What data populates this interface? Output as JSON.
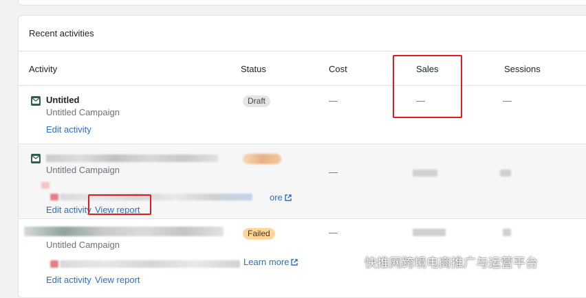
{
  "card": {
    "title": "Recent activities"
  },
  "columns": [
    "Activity",
    "Status",
    "Cost",
    "Sales",
    "Sessions"
  ],
  "rows": [
    {
      "name": "Untitled",
      "subtitle": "Untitled Campaign",
      "status": "Draft",
      "cost": "—",
      "sales": "—",
      "sessions": "—",
      "links": [
        "Edit activity"
      ]
    },
    {
      "subtitle": "Untitled Campaign",
      "cost": "—",
      "info_link": "ore",
      "links": [
        "Edit activity",
        "View report"
      ]
    },
    {
      "subtitle": "Untitled Campaign",
      "status": "Failed",
      "cost": "—",
      "info_link": "Learn more",
      "links": [
        "Edit activity",
        "View report"
      ]
    }
  ],
  "watermark": "快推网跨境电商推广与运营平台",
  "colors": {
    "link": "#2c6ecb",
    "highlight": "#e11b1b",
    "icon": "#2f5f48"
  }
}
